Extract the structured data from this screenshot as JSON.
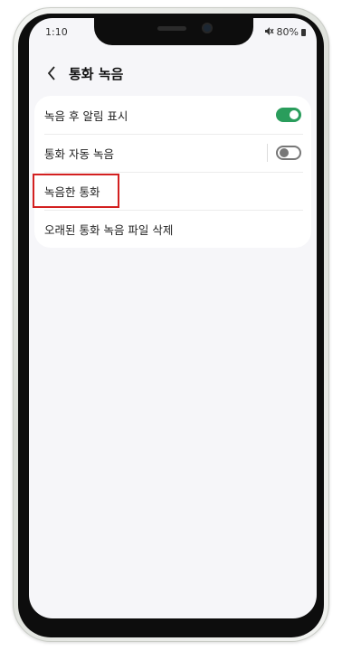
{
  "status_bar": {
    "time": "1:10",
    "battery": "80%"
  },
  "header": {
    "title": "통화 녹음"
  },
  "settings": {
    "items": [
      {
        "label": "녹음 후 알림 표시",
        "toggle": true
      },
      {
        "label": "통화 자동 녹음",
        "toggle": false
      },
      {
        "label": "녹음한 통화"
      },
      {
        "label": "오래된 통화 녹음 파일 삭제"
      }
    ]
  },
  "colors": {
    "toggle_on": "#2a9d5c",
    "highlight": "#d32020"
  }
}
